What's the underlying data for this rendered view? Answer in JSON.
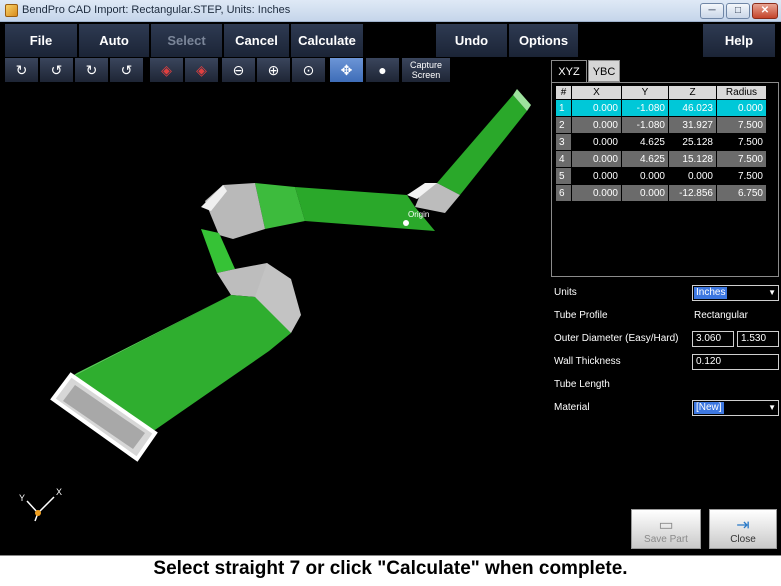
{
  "window": {
    "title": "BendPro CAD Import: Rectangular.STEP, Units: Inches",
    "minimize": "─",
    "maximize": "□",
    "close": "✕"
  },
  "menu": {
    "file": "File",
    "auto": "Auto",
    "select": "Select",
    "cancel": "Cancel",
    "calculate": "Calculate",
    "undo": "Undo",
    "options": "Options",
    "help": "Help"
  },
  "toolbar": {
    "capture_line1": "Capture",
    "capture_line2": "Screen"
  },
  "tabs": {
    "xyz": "XYZ",
    "ybc": "YBC"
  },
  "table": {
    "headers": [
      "#",
      "X",
      "Y",
      "Z",
      "Radius"
    ],
    "rows": [
      {
        "n": "1",
        "x": "0.000",
        "y": "-1.080",
        "z": "46.023",
        "r": "0.000"
      },
      {
        "n": "2",
        "x": "0.000",
        "y": "-1.080",
        "z": "31.927",
        "r": "7.500"
      },
      {
        "n": "3",
        "x": "0.000",
        "y": "4.625",
        "z": "25.128",
        "r": "7.500"
      },
      {
        "n": "4",
        "x": "0.000",
        "y": "4.625",
        "z": "15.128",
        "r": "7.500"
      },
      {
        "n": "5",
        "x": "0.000",
        "y": "0.000",
        "z": "0.000",
        "r": "7.500"
      },
      {
        "n": "6",
        "x": "0.000",
        "y": "0.000",
        "z": "-12.856",
        "r": "6.750"
      }
    ]
  },
  "props": {
    "units_label": "Units",
    "units_value": "Inches",
    "profile_label": "Tube Profile",
    "profile_value": "Rectangular",
    "od_label": "Outer Diameter (Easy/Hard)",
    "od_easy": "3.060",
    "od_hard": "1.530",
    "wall_label": "Wall Thickness",
    "wall_value": "0.120",
    "length_label": "Tube Length",
    "material_label": "Material",
    "material_value": "[New]"
  },
  "buttons": {
    "save_part": "Save Part",
    "close": "Close"
  },
  "viewport": {
    "origin_label": "Origin",
    "axis_x": "X",
    "axis_y": "Y"
  },
  "status": "Select straight 7 or click \"Calculate\" when complete."
}
